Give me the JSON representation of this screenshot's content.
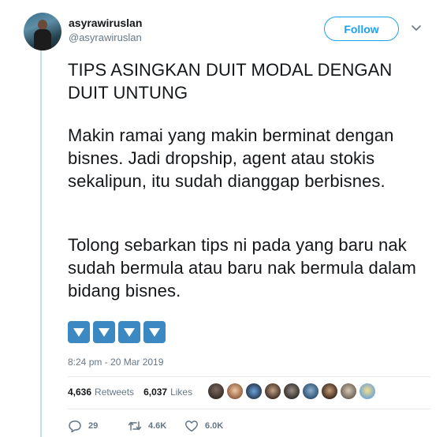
{
  "user": {
    "display_name": "asyrawiruslan",
    "handle": "@asyrawiruslan"
  },
  "follow_label": "Follow",
  "tweet": {
    "title_line": "TIPS ASINGKAN DUIT MODAL DENGAN DUIT UNTUNG",
    "paragraph_1": "Makin ramai yang makin berminat dengan bisnes. Jadi dropship, agent atau stokis sekalipun, itu sudah dianggap berbisnes.",
    "paragraph_2": "Tolong sebarkan tips ni pada yang baru nak sudah bermula atau baru nak bermula dalam bidang bisnes.",
    "emoji_count_label": "down-arrow-button-emoji x4"
  },
  "timestamp": "8:24 pm - 20 Mar 2019",
  "stats": {
    "retweets_count": "4,636",
    "retweets_label": "Retweets",
    "likes_count": "6,037",
    "likes_label": "Likes"
  },
  "actions": {
    "reply_count": "29",
    "retweet_count": "4.6K",
    "like_count": "6.0K"
  },
  "colors": {
    "accent": "#1da1f2",
    "secondary_text": "#657786",
    "emoji_blue": "#3b88c3"
  }
}
